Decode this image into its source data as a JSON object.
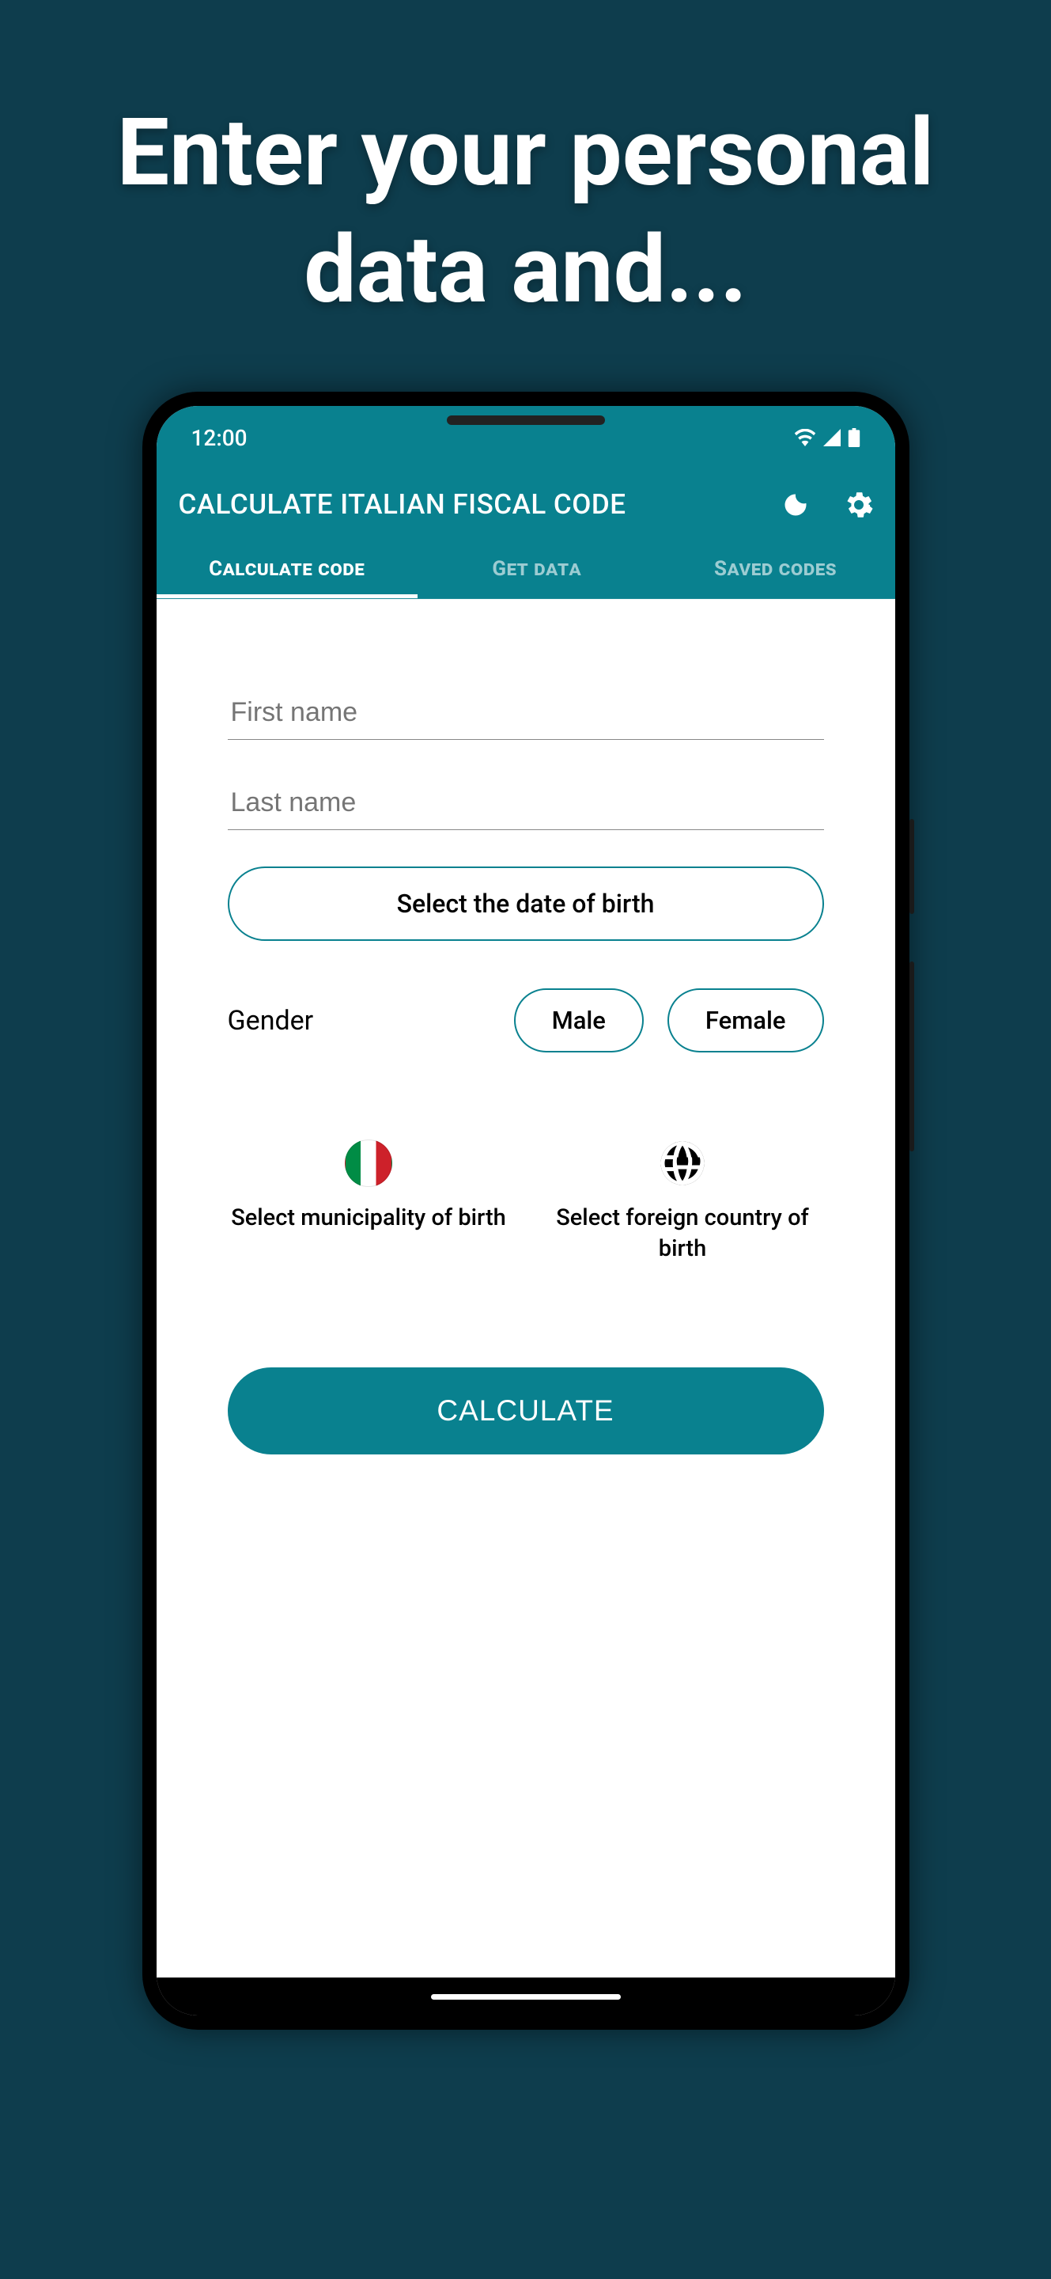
{
  "promo": "Enter your personal data and...",
  "statusBar": {
    "time": "12:00"
  },
  "header": {
    "title": "CALCULATE ITALIAN FISCAL CODE"
  },
  "tabs": {
    "calculate": "Calculate code",
    "getData": "Get data",
    "saved": "Saved codes"
  },
  "form": {
    "firstName": {
      "placeholder": "First name",
      "value": ""
    },
    "lastName": {
      "placeholder": "Last name",
      "value": ""
    },
    "dateOfBirth": "Select the date of birth",
    "genderLabel": "Gender",
    "male": "Male",
    "female": "Female",
    "municipality": "Select municipality of birth",
    "foreign": "Select foreign country of birth",
    "calculate": "CALCULATE"
  },
  "colors": {
    "accent": "#09818f",
    "bg": "#0e3d4d"
  }
}
